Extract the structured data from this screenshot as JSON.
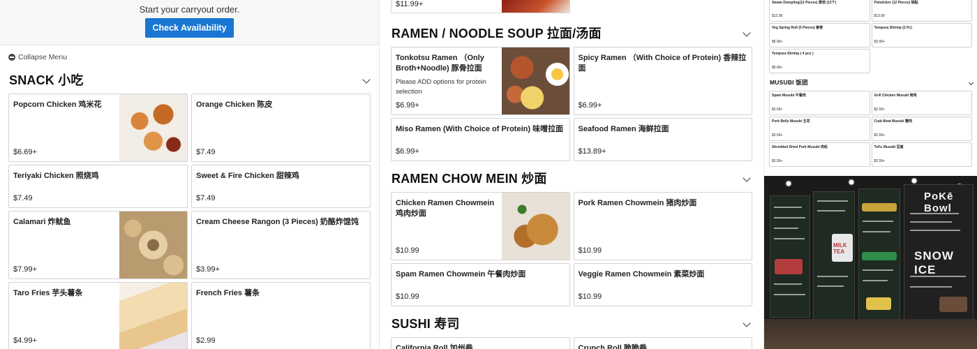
{
  "carryout": {
    "message": "Start your carryout order.",
    "button_label": "Check Availability"
  },
  "collapse_menu_label": "Collapse Menu",
  "snack": {
    "title": "SNACK 小吃",
    "items": [
      {
        "name": "Popcorn Chicken 鸡米花",
        "price": "$6.69+",
        "thumb": true
      },
      {
        "name": "Orange Chicken 陈皮",
        "price": "$7.49",
        "thumb": false
      },
      {
        "name": "Teriyaki Chicken 照烧鸡",
        "price": "$7.49",
        "thumb": false
      },
      {
        "name": "Sweet & Fire Chicken 甜辣鸡",
        "price": "$7.49",
        "thumb": false
      },
      {
        "name": "Calamari 炸鱿鱼",
        "price": "$7.99+",
        "thumb": true
      },
      {
        "name": "Cream Cheese Rangon (3 Pieces) 奶酪炸馄饨",
        "price": "$3.99+",
        "thumb": false
      },
      {
        "name": "Taro Fries 芋头薯条",
        "price": "$4.99+",
        "thumb": true
      },
      {
        "name": "French Fries 薯条",
        "price": "$2.99",
        "thumb": false
      }
    ]
  },
  "top_partial": {
    "price": "$11.99+"
  },
  "ramen_soup": {
    "title": "RAMEN / NOODLE SOUP 拉面/汤面",
    "items": [
      {
        "name": "Tonkotsu Ramen （Only Broth+Noodle) 豚骨拉面",
        "desc": "Please ADD options for protein selection",
        "price": "$6.99+",
        "thumb": true
      },
      {
        "name": "Spicy Ramen （With Choice of Protein) 香辣拉面",
        "desc": "",
        "price": "$6.99+",
        "thumb": false
      },
      {
        "name": "Miso Ramen (With Choice of Protein) 味噌拉面",
        "desc": "",
        "price": "$6.99+",
        "thumb": false
      },
      {
        "name": "Seafood Ramen 海鲜拉面",
        "desc": "",
        "price": "$13.89+",
        "thumb": false
      }
    ]
  },
  "chow_mein": {
    "title": "RAMEN CHOW MEIN 炒面",
    "items": [
      {
        "name": "Chicken Ramen Chowmein 鸡肉炒面",
        "price": "$10.99",
        "thumb": true
      },
      {
        "name": "Pork Ramen Chowmein 猪肉炒面",
        "price": "$10.99",
        "thumb": false
      },
      {
        "name": "Spam Ramen Chowmein 午餐肉炒面",
        "price": "$10.99",
        "thumb": false
      },
      {
        "name": "Veggie Ramen Chowmein 素菜炒面",
        "price": "$10.99",
        "thumb": false
      }
    ]
  },
  "sushi": {
    "title": "SUSHI 寿司",
    "items": [
      {
        "name": "California Roll 加州卷"
      },
      {
        "name": "Crunch Roll 脆脆卷"
      }
    ]
  },
  "right_top": {
    "items": [
      {
        "name": "Steam Dumpling(12 Pieces) 蒸饺 (12个)",
        "price": "$12.99"
      },
      {
        "name": "Potsticker (12 Pieces) 锅贴",
        "price": "$13.99"
      },
      {
        "name": "Veg Spring Roll (5 Pieces) 春卷",
        "price": "$5.99+"
      },
      {
        "name": "Tempura Shrimp (2 Pc)",
        "price": "$3.99+"
      },
      {
        "name": "Tempura Shrimp ( 4 pcs )",
        "price": "$6.99+"
      }
    ]
  },
  "musubi": {
    "title": "MUSUBI 饭团",
    "items": [
      {
        "name": "Spam Musubi 午餐肉",
        "price": "$2.59+"
      },
      {
        "name": "Grill Chicken Musubi 烤鸡",
        "price": "$2.59+"
      },
      {
        "name": "Pork Belly Musubi 五花",
        "price": "$2.59+"
      },
      {
        "name": "Crab Meat Musubi 蟹肉",
        "price": "$2.59+"
      },
      {
        "name": "Shredded Dried Pork Musubi 肉松",
        "price": "$2.59+"
      },
      {
        "name": "ToFu Musubi 豆腐",
        "price": "$2.59+"
      }
    ]
  },
  "board_text": {
    "poke": "PoKē Bowl",
    "snow": "SNOW ICE",
    "milk": "MILK TEA"
  }
}
